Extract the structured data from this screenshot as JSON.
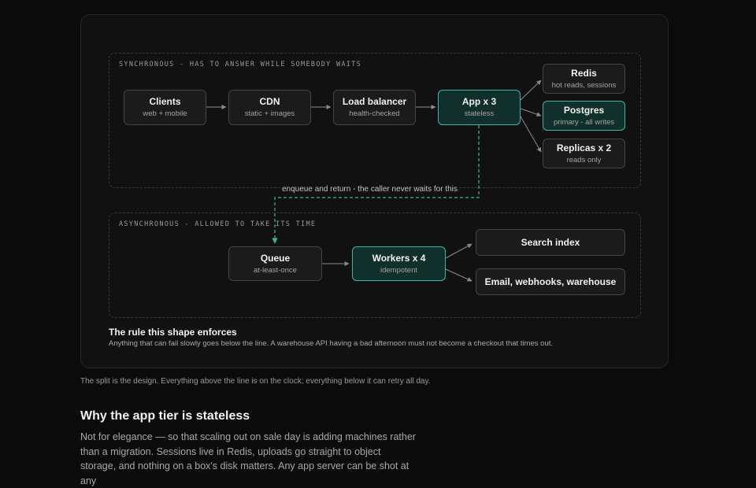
{
  "sync_zone": {
    "label": "SYNCHRONOUS - HAS TO ANSWER WHILE SOMEBODY WAITS"
  },
  "async_zone": {
    "label": "ASYNCHRONOUS - ALLOWED TO TAKE ITS TIME"
  },
  "nodes": {
    "clients": {
      "title": "Clients",
      "subtitle": "web + mobile"
    },
    "cdn": {
      "title": "CDN",
      "subtitle": "static + images"
    },
    "load_balancer": {
      "title": "Load balancer",
      "subtitle": "health-checked"
    },
    "app": {
      "title": "App x 3",
      "subtitle": "stateless",
      "highlighted": true
    },
    "redis": {
      "title": "Redis",
      "subtitle": "hot reads, sessions"
    },
    "postgres": {
      "title": "Postgres",
      "subtitle": "primary - all writes",
      "highlighted": true
    },
    "replicas": {
      "title": "Replicas x 2",
      "subtitle": "reads only"
    },
    "queue": {
      "title": "Queue",
      "subtitle": "at-least-once"
    },
    "workers": {
      "title": "Workers x 4",
      "subtitle": "idempotent",
      "highlighted": true
    },
    "search": {
      "title": "Search index"
    },
    "email": {
      "title": "Email, webhooks, warehouse"
    }
  },
  "edges": {
    "enqueue_label": "enqueue and return - the caller never waits for this"
  },
  "rule": {
    "title": "The rule this shape enforces",
    "body": "Anything that can fail slowly goes below the line. A warehouse API having a bad afternoon must not become a checkout that times out."
  },
  "caption": "The split is the design. Everything above the line is on the clock; everything below it can retry all day.",
  "section": {
    "heading": "Why the app tier is stateless",
    "paragraph": "Not for elegance — so that scaling out on sale day is adding machines rather than a migration. Sessions live in Redis, uploads go straight to object storage, and nothing on a box's disk matters. Any app server can be shot at any"
  },
  "colors": {
    "accent": "#3fb4a2",
    "highlight_fill": "#12302b",
    "background": "#0b0b0b",
    "card": "#111111"
  }
}
